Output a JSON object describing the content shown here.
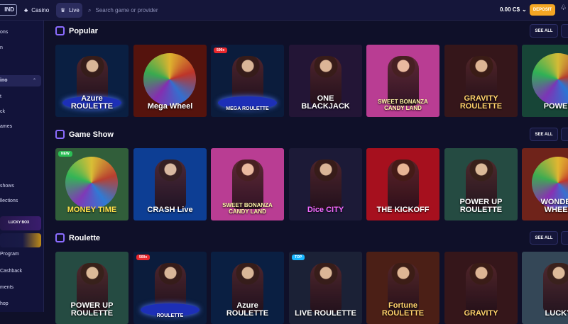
{
  "header": {
    "logo_text": "IND",
    "casino_label": "Casino",
    "live_label": "Live",
    "search_placeholder": "Search game or provider",
    "balance": "0.00 C$",
    "deposit_label": "DEPOSIT"
  },
  "sidebar": {
    "items": [
      "ons",
      "n",
      "ino",
      "t",
      "ck",
      "ames",
      "shows",
      "llections",
      "Program",
      "Cashback",
      "ments",
      "hop"
    ],
    "promos": [
      "LUCKY BOX"
    ]
  },
  "sections": [
    {
      "title": "Popular",
      "see_all": "SEE ALL",
      "games": [
        {
          "label": "Azure ROULETTE",
          "sub": "",
          "badge": "",
          "color": "#0a1f42"
        },
        {
          "label": "Mega Wheel",
          "sub": "",
          "badge": "",
          "color": "#55130d"
        },
        {
          "label": "MEGA ROULETTE",
          "sub": "",
          "badge": "500x",
          "color": "#0b1c3c"
        },
        {
          "label": "ONE BLACKJACK",
          "sub": "",
          "badge": "",
          "color": "#231536"
        },
        {
          "label": "SWEET BONANZA CANDY LAND",
          "sub": "",
          "badge": "",
          "color": "#b93d93"
        },
        {
          "label": "GRAVITY ROULETTE",
          "sub": "",
          "badge": "",
          "color": "#35161a"
        },
        {
          "label": "POWER",
          "sub": "",
          "badge": "",
          "color": "#174537"
        }
      ]
    },
    {
      "title": "Game Show",
      "see_all": "SEE ALL",
      "games": [
        {
          "label": "MONEY TIME",
          "sub": "",
          "badge": "NEW",
          "color": "#315e3a"
        },
        {
          "label": "CRASH Live",
          "sub": "",
          "badge": "",
          "color": "#0d3e94"
        },
        {
          "label": "SWEET BONANZA CANDY LAND",
          "sub": "",
          "badge": "",
          "color": "#b93d93"
        },
        {
          "label": "Dice CITY",
          "sub": "",
          "badge": "",
          "color": "#1c1a37"
        },
        {
          "label": "THE KICKOFF",
          "sub": "",
          "badge": "",
          "color": "#a6101e"
        },
        {
          "label": "POWER UP ROULETTE",
          "sub": "",
          "badge": "",
          "color": "#254b42"
        },
        {
          "label": "WONDER WHEEL",
          "sub": "",
          "badge": "",
          "color": "#6f231a"
        }
      ]
    },
    {
      "title": "Roulette",
      "see_all": "SEE ALL",
      "games": [
        {
          "label": "POWER UP ROULETTE",
          "sub": "",
          "badge": "",
          "color": "#254b42"
        },
        {
          "label": "ROULETTE",
          "sub": "",
          "badge": "500x",
          "color": "#0b1c3c"
        },
        {
          "label": "Azure ROULETTE",
          "sub": "",
          "badge": "",
          "color": "#0a1f42"
        },
        {
          "label": "LIVE ROULETTE",
          "sub": "",
          "badge": "TOP",
          "color": "#1b2136"
        },
        {
          "label": "Fortune ROULETTE",
          "sub": "",
          "badge": "",
          "color": "#4b1f16"
        },
        {
          "label": "GRAVITY",
          "sub": "",
          "badge": "",
          "color": "#35161a"
        },
        {
          "label": "LUCKY",
          "sub": "",
          "badge": "",
          "color": "#344757"
        }
      ]
    }
  ]
}
